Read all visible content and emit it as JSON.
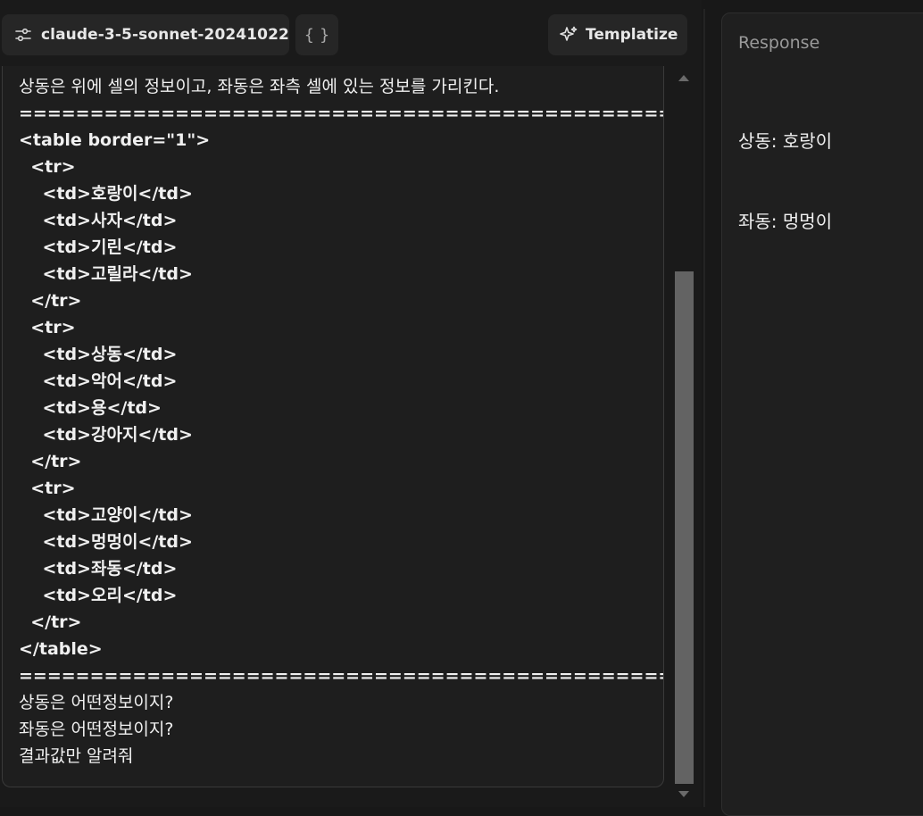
{
  "toolbar": {
    "model_label": "claude-3-5-sonnet-20241022",
    "json_label": "{ }",
    "templatize_label": "Templatize"
  },
  "prompt": {
    "lines": [
      {
        "text": "상동은 위에 셀의 정보이고, 좌동은 좌측 셀에 있는 정보를 가리킨다.",
        "style": "ko"
      },
      {
        "text": "==============================================",
        "style": "code"
      },
      {
        "text": "<table border=\"1\">",
        "style": "code"
      },
      {
        "text": "  <tr>",
        "style": "code"
      },
      {
        "text": "    <td>호랑이</td>",
        "style": "code"
      },
      {
        "text": "    <td>사자</td>",
        "style": "code"
      },
      {
        "text": "    <td>기린</td>",
        "style": "code"
      },
      {
        "text": "    <td>고릴라</td>",
        "style": "code"
      },
      {
        "text": "  </tr>",
        "style": "code"
      },
      {
        "text": "  <tr>",
        "style": "code"
      },
      {
        "text": "    <td>상동</td>",
        "style": "code"
      },
      {
        "text": "    <td>악어</td>",
        "style": "code"
      },
      {
        "text": "    <td>용</td>",
        "style": "code"
      },
      {
        "text": "    <td>강아지</td>",
        "style": "code"
      },
      {
        "text": "  </tr>",
        "style": "code"
      },
      {
        "text": "  <tr>",
        "style": "code"
      },
      {
        "text": "    <td>고양이</td>",
        "style": "code"
      },
      {
        "text": "    <td>멍멍이</td>",
        "style": "code"
      },
      {
        "text": "    <td>좌동</td>",
        "style": "code"
      },
      {
        "text": "    <td>오리</td>",
        "style": "code"
      },
      {
        "text": "  </tr>",
        "style": "code"
      },
      {
        "text": "</table>",
        "style": "code"
      },
      {
        "text": "==============================================",
        "style": "code"
      },
      {
        "text": "상동은 어떤정보이지?",
        "style": "ko"
      },
      {
        "text": "좌동은 어떤정보이지?",
        "style": "ko"
      },
      {
        "text": "결과값만 알려줘",
        "style": "ko"
      }
    ]
  },
  "response": {
    "title": "Response",
    "lines": [
      "상동: 호랑이",
      "좌동: 멍멍이"
    ]
  },
  "icons": {
    "model": "sliders-icon",
    "templatize": "sparkle-icon"
  },
  "colors": {
    "background": "#181818",
    "panel": "#1e1e1e",
    "button": "#262626",
    "text": "#ececec",
    "muted": "#9a9a9a",
    "scroll_thumb": "#636363"
  }
}
